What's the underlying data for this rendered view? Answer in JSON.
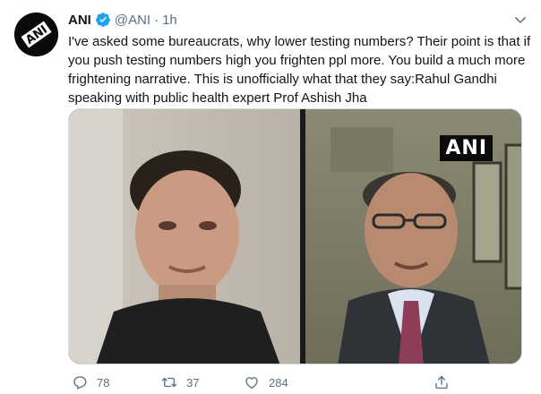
{
  "tweet": {
    "author_name": "ANI",
    "author_handle": "@ANI",
    "separator": "·",
    "timestamp": "1h",
    "text": "I've asked some bureaucrats, why lower testing numbers? Their point is that if you push testing numbers high you frighten ppl more. You build a much more frightening narrative. This is unofficially what that they say:Rahul Gandhi speaking with public health expert Prof Ashish Jha",
    "verified": true
  },
  "avatar": {
    "logo_text": "ANI"
  },
  "media": {
    "watermark": "ANI"
  },
  "actions": {
    "reply_count": "78",
    "retweet_count": "37",
    "like_count": "284"
  },
  "icons": {
    "verified": "verified-badge-icon",
    "caret": "chevron-down-icon",
    "reply": "reply-icon",
    "retweet": "retweet-icon",
    "like": "heart-icon",
    "share": "share-icon"
  },
  "colors": {
    "verified_blue": "#1da1f2",
    "secondary_text": "#5b7083"
  }
}
